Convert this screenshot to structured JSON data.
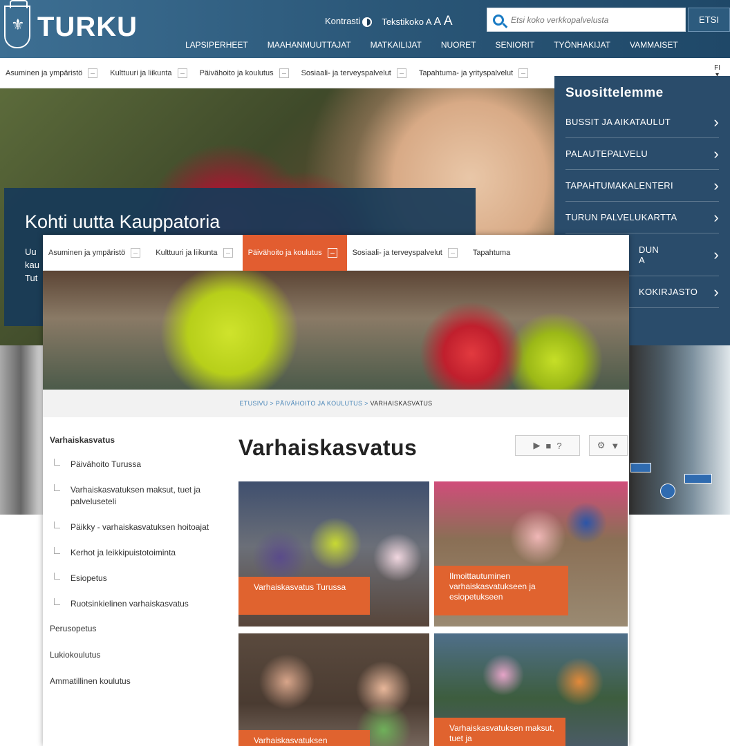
{
  "header": {
    "logo_text": "TURKU",
    "logo_crest": "⚜",
    "contrast_label": "Kontrasti",
    "textsize_label": "Tekstikoko",
    "textsize_small": "A",
    "textsize_medium": "A",
    "textsize_large": "A",
    "search_placeholder": "Etsi koko verkkopalvelusta",
    "search_button": "ETSI",
    "nav": [
      "LAPSIPERHEET",
      "MAAHANMUUTTAJAT",
      "MATKAILIJAT",
      "NUORET",
      "SENIORIT",
      "TYÖNHAKIJAT",
      "VAMMAISET"
    ]
  },
  "category_bar": {
    "items": [
      "Asuminen ja ympäristö",
      "Kulttuuri ja liikunta",
      "Päivähoito ja koulutus",
      "Sosiaali- ja terveyspalvelut",
      "Tapahtuma- ja yrityspalvelut"
    ],
    "language": "FI"
  },
  "hero": {
    "title": "Kohti uutta Kauppatoria",
    "text_lines": [
      "Uu",
      "kau",
      "Tut"
    ]
  },
  "recommendations": {
    "title": "Suosittelemme",
    "items": [
      "BUSSIT JA AIKATAULUT",
      "PALAUTEPALVELU",
      "TAPAHTUMAKALENTERI",
      "TURUN PALVELUKARTTA",
      "DUN\nA",
      "KOKIRJASTO"
    ]
  },
  "overlay": {
    "categories": [
      "Asuminen ja ympäristö",
      "Kulttuuri ja liikunta",
      "Päivähoito ja koulutus",
      "Sosiaali- ja terveyspalvelut",
      "Tapahtuma"
    ],
    "active_category": "Päivähoito ja koulutus",
    "breadcrumb": {
      "home": "ETUSIVU",
      "section": "PÄIVÄHOITO JA KOULUTUS",
      "current": "VARHAISKASVATUS",
      "separator": ">"
    },
    "page_title": "Varhaiskasvatus",
    "media_controls": {
      "play": "▶",
      "stop": "■",
      "help": "?"
    },
    "settings_controls": {
      "gear": "⚙",
      "dropdown": "▼"
    },
    "sidenav": {
      "heading": "Varhaiskasvatus",
      "sub_items": [
        "Päivähoito Turussa",
        "Varhaiskasvatuksen maksut, tuet ja palveluseteli",
        "Päikky - varhaiskasvatuksen hoitoajat",
        "Kerhot ja leikkipuistotoiminta",
        "Esiopetus",
        "Ruotsinkielinen varhaiskasvatus"
      ],
      "top_items": [
        "Perusopetus",
        "Lukiokoulutus",
        "Ammatillinen koulutus"
      ]
    },
    "tiles": [
      {
        "label": "Varhaiskasvatus Turussa"
      },
      {
        "label": "Ilmoittautuminen varhaiskasvatukseen ja esiopetukseen"
      },
      {
        "label": "Varhaiskasvatuksen"
      },
      {
        "label": "Varhaiskasvatuksen maksut, tuet ja"
      }
    ]
  },
  "colors": {
    "header_blue": "#2a5677",
    "accent_orange": "#e25d30",
    "link_blue": "#4a86b8",
    "panel_navy": "#1f4263"
  }
}
